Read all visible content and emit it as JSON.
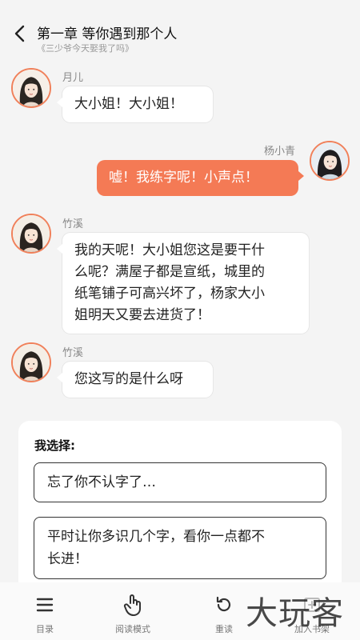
{
  "header": {
    "title": "第一章 等你遇到那个人",
    "subtitle": "《三少爷今天娶我了吗》"
  },
  "messages": [
    {
      "speaker": "月儿",
      "text": "大小姐！大小姐！",
      "side": "left"
    },
    {
      "speaker": "杨小青",
      "text": "嘘！我练字呢！小声点！",
      "side": "right"
    },
    {
      "speaker": "竹溪",
      "text_lines": [
        "我的天呢！大小姐您这是要干什",
        "么呢？满屋子都是宣纸，城里的",
        "纸笔铺子可高兴坏了，杨家大小",
        "姐明天又要去进货了！"
      ],
      "side": "left"
    },
    {
      "speaker": "竹溪",
      "text": "您这写的是什么呀",
      "side": "left"
    }
  ],
  "choices": {
    "heading": "我选择:",
    "options": [
      {
        "lines": [
          "忘了你不认字了…"
        ]
      },
      {
        "lines": [
          "平时让你多识几个字，看你一点都不",
          "长进！"
        ]
      }
    ]
  },
  "toolbar": {
    "items": [
      {
        "label": "目录",
        "icon": "menu-icon"
      },
      {
        "label": "阅读模式",
        "icon": "tap-hand-icon"
      },
      {
        "label": "重读",
        "icon": "replay-icon"
      },
      {
        "label": "加入书架",
        "icon": "bookshelf-icon"
      }
    ]
  },
  "watermark": {
    "text": "大玩客"
  },
  "colors": {
    "accent": "#f47a55",
    "avatar_border": "#f0805a",
    "background": "#f4f4f4"
  }
}
